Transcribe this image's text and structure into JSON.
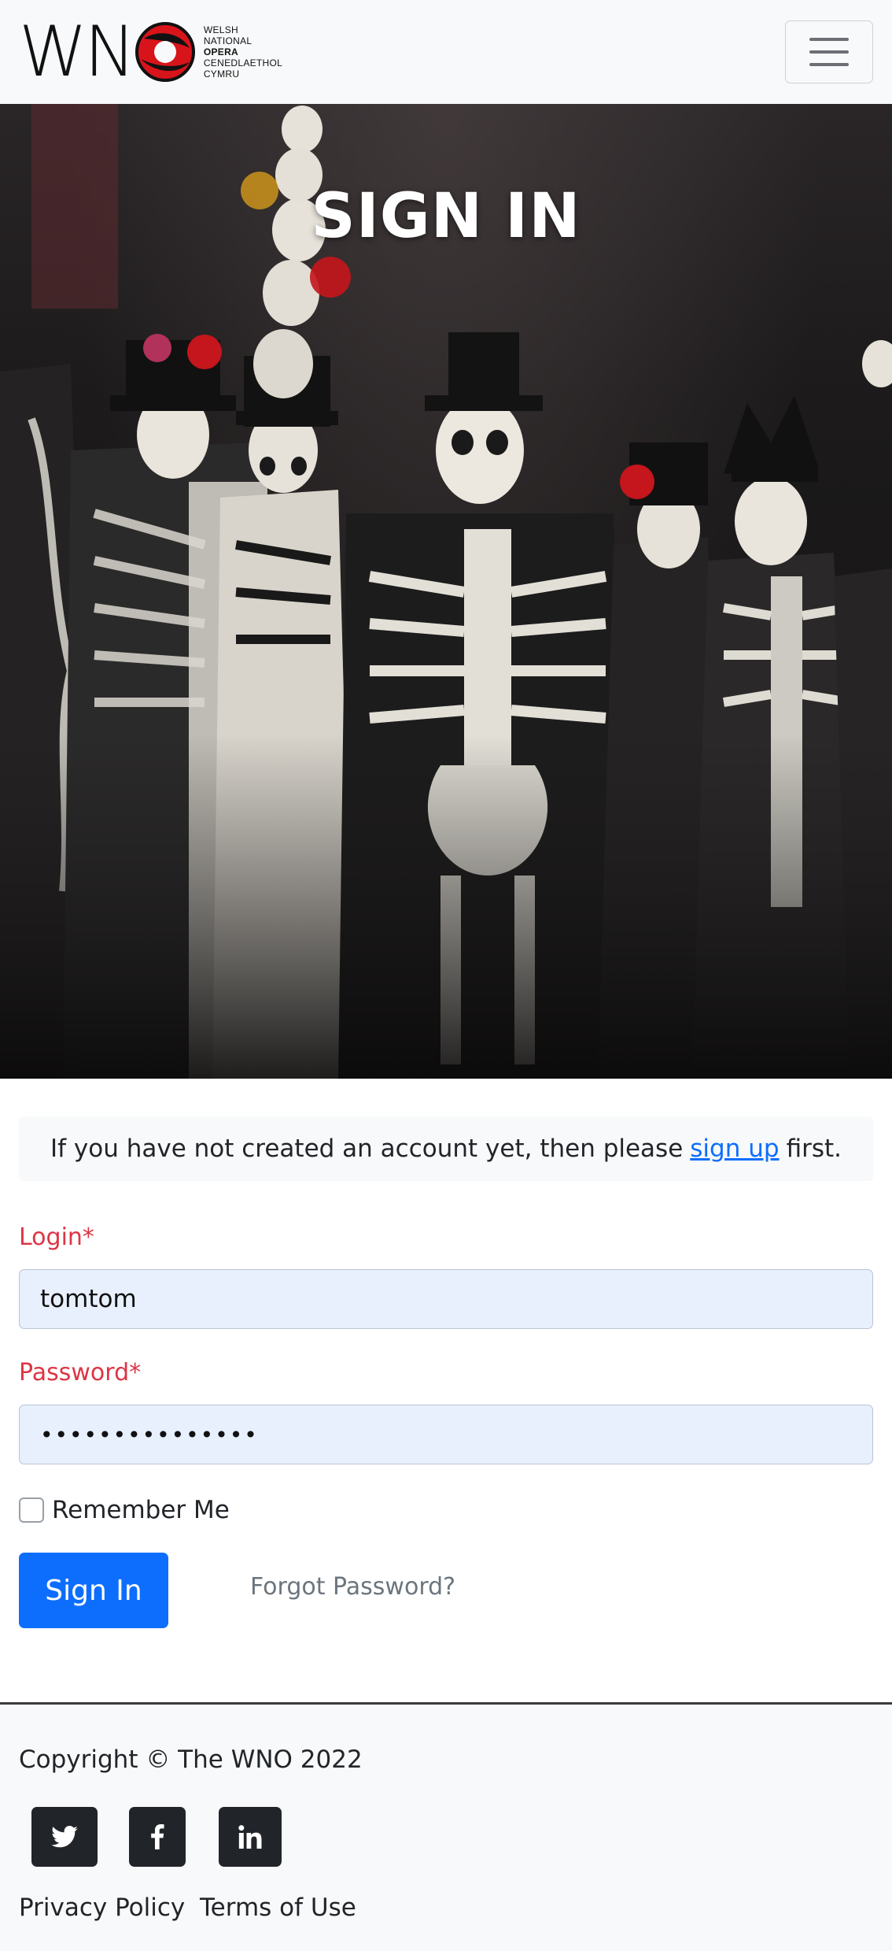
{
  "brand": {
    "logo_letters": "WN",
    "logo_lines": [
      "WELSH",
      "NATIONAL",
      "OPERA",
      "CENEDLAETHOL",
      "CYMRU"
    ],
    "accent_red": "#d7141a"
  },
  "navbar": {
    "toggler_icon": "hamburger-icon"
  },
  "hero": {
    "title": "SIGN IN"
  },
  "notice": {
    "prefix": "If you have not created an account yet, then please",
    "link": "sign up",
    "suffix": "first."
  },
  "form": {
    "login_label": "Login*",
    "login_value": "tomtom",
    "password_label": "Password*",
    "password_value": "•••••••••••••••",
    "remember_label": "Remember Me",
    "remember_checked": false,
    "submit_label": "Sign In",
    "forgot_label": "Forgot Password?"
  },
  "colors": {
    "primary": "#0d6efd",
    "danger": "#dc3545",
    "input_bg": "#e8f0fe",
    "footer_icon_bg": "#212529"
  },
  "footer": {
    "copyright": "Copyright © The WNO 2022",
    "social": [
      {
        "name": "twitter-icon"
      },
      {
        "name": "facebook-icon"
      },
      {
        "name": "linkedin-icon"
      }
    ],
    "links": [
      "Privacy Policy",
      "Terms of Use"
    ]
  }
}
